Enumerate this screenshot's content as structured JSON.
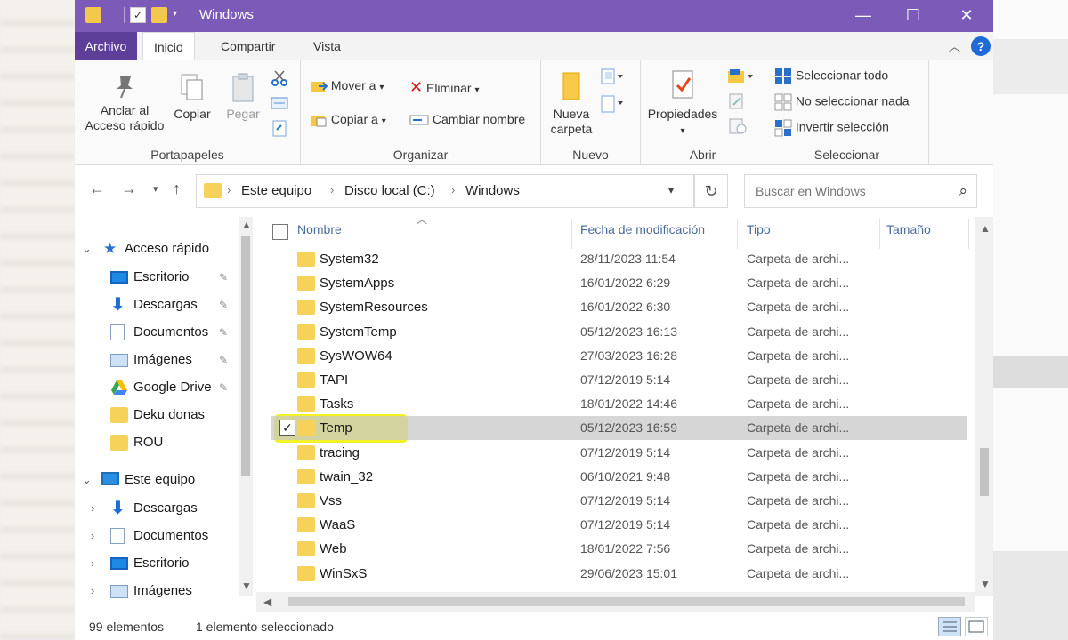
{
  "window": {
    "title": "Windows",
    "minimize": "—",
    "maximize": "☐",
    "close": "✕",
    "accent": "#7b5ab8"
  },
  "ribbon_tabs": [
    {
      "label": "Archivo"
    },
    {
      "label": "Inicio",
      "active": true
    },
    {
      "label": "Compartir"
    },
    {
      "label": "Vista"
    }
  ],
  "ribbon": {
    "portapapeles": {
      "label": "Portapapeles",
      "pin_label_1": "Anclar al",
      "pin_label_2": "Acceso rápido",
      "copy": "Copiar",
      "paste": "Pegar"
    },
    "organizar": {
      "label": "Organizar",
      "move": "Mover a",
      "copy_to": "Copiar a",
      "delete": "Eliminar",
      "rename": "Cambiar nombre"
    },
    "nuevo": {
      "label": "Nuevo",
      "new_folder_1": "Nueva",
      "new_folder_2": "carpeta"
    },
    "abrir": {
      "label": "Abrir",
      "properties": "Propiedades"
    },
    "seleccionar": {
      "label": "Seleccionar",
      "select_all": "Seleccionar todo",
      "select_none": "No seleccionar nada",
      "invert": "Invertir selección"
    }
  },
  "address": {
    "crumbs": [
      "Este equipo",
      "Disco local (C:)",
      "Windows"
    ],
    "search_placeholder": "Buscar en Windows"
  },
  "nav": {
    "quick_access": "Acceso rápido",
    "quick_items": [
      {
        "label": "Escritorio",
        "icon": "desktop-icon"
      },
      {
        "label": "Descargas",
        "icon": "download-icon"
      },
      {
        "label": "Documentos",
        "icon": "document-icon"
      },
      {
        "label": "Imágenes",
        "icon": "image-icon"
      },
      {
        "label": "Google Drive",
        "icon": "google-drive-icon"
      },
      {
        "label": "Deku donas",
        "icon": "folder-icon"
      },
      {
        "label": "ROU",
        "icon": "folder-icon"
      }
    ],
    "this_pc": "Este equipo",
    "pc_items": [
      {
        "label": "Descargas",
        "icon": "download-icon"
      },
      {
        "label": "Documentos",
        "icon": "document-icon"
      },
      {
        "label": "Escritorio",
        "icon": "desktop-icon"
      },
      {
        "label": "Imágenes",
        "icon": "image-icon"
      }
    ]
  },
  "columns": {
    "name": "Nombre",
    "date": "Fecha de modificación",
    "type": "Tipo",
    "size": "Tamaño"
  },
  "files": [
    {
      "name": "System32",
      "date": "28/11/2023 11:54",
      "type": "Carpeta de archi..."
    },
    {
      "name": "SystemApps",
      "date": "16/01/2022 6:29",
      "type": "Carpeta de archi..."
    },
    {
      "name": "SystemResources",
      "date": "16/01/2022 6:30",
      "type": "Carpeta de archi..."
    },
    {
      "name": "SystemTemp",
      "date": "05/12/2023 16:13",
      "type": "Carpeta de archi..."
    },
    {
      "name": "SysWOW64",
      "date": "27/03/2023 16:28",
      "type": "Carpeta de archi..."
    },
    {
      "name": "TAPI",
      "date": "07/12/2019 5:14",
      "type": "Carpeta de archi..."
    },
    {
      "name": "Tasks",
      "date": "18/01/2022 14:46",
      "type": "Carpeta de archi..."
    },
    {
      "name": "Temp",
      "date": "05/12/2023 16:59",
      "type": "Carpeta de archi...",
      "selected": true
    },
    {
      "name": "tracing",
      "date": "07/12/2019 5:14",
      "type": "Carpeta de archi..."
    },
    {
      "name": "twain_32",
      "date": "06/10/2021 9:48",
      "type": "Carpeta de archi..."
    },
    {
      "name": "Vss",
      "date": "07/12/2019 5:14",
      "type": "Carpeta de archi..."
    },
    {
      "name": "WaaS",
      "date": "07/12/2019 5:14",
      "type": "Carpeta de archi..."
    },
    {
      "name": "Web",
      "date": "18/01/2022 7:56",
      "type": "Carpeta de archi..."
    },
    {
      "name": "WinSxS",
      "date": "29/06/2023 15:01",
      "type": "Carpeta de archi..."
    }
  ],
  "status": {
    "count": "99 elementos",
    "selection": "1 elemento seleccionado"
  },
  "highlight_color": "#f1f21a"
}
